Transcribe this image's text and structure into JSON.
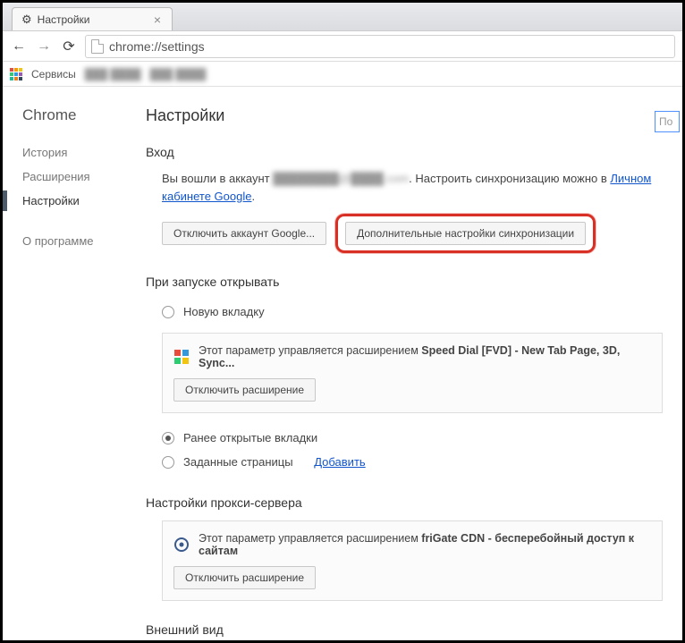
{
  "tab": {
    "title": "Настройки"
  },
  "omnibox": {
    "url": "chrome://settings"
  },
  "bookmarks": {
    "apps_label": "Сервисы"
  },
  "sidebar": {
    "brand": "Chrome",
    "items": [
      {
        "label": "История",
        "active": false
      },
      {
        "label": "Расширения",
        "active": false
      },
      {
        "label": "Настройки",
        "active": true
      }
    ],
    "about": "О программе"
  },
  "page": {
    "title": "Настройки",
    "search_placeholder": "По"
  },
  "signin": {
    "heading": "Вход",
    "text_before": "Вы вошли в аккаунт ",
    "account_blurred": "████████@████.com",
    "text_mid": ". Настроить синхронизацию можно в ",
    "link_text": "Личном кабинете Google",
    "text_after": ".",
    "disconnect_btn": "Отключить аккаунт Google...",
    "advanced_sync_btn": "Дополнительные настройки синхронизации"
  },
  "startup": {
    "heading": "При запуске открывать",
    "opt_newtab": "Новую вкладку",
    "opt_continue": "Ранее открытые вкладки",
    "opt_specific": "Заданные страницы",
    "add_link": "Добавить",
    "selected": "continue",
    "ext_notice_prefix": "Этот параметр управляется расширением ",
    "ext_name": "Speed Dial [FVD] - New Tab Page, 3D, Sync...",
    "disable_ext_btn": "Отключить расширение"
  },
  "proxy": {
    "heading": "Настройки прокси-сервера",
    "ext_notice_prefix": "Этот параметр управляется расширением ",
    "ext_name": "friGate CDN - бесперебойный доступ к сайтам",
    "disable_ext_btn": "Отключить расширение"
  },
  "appearance": {
    "heading": "Внешний вид"
  }
}
